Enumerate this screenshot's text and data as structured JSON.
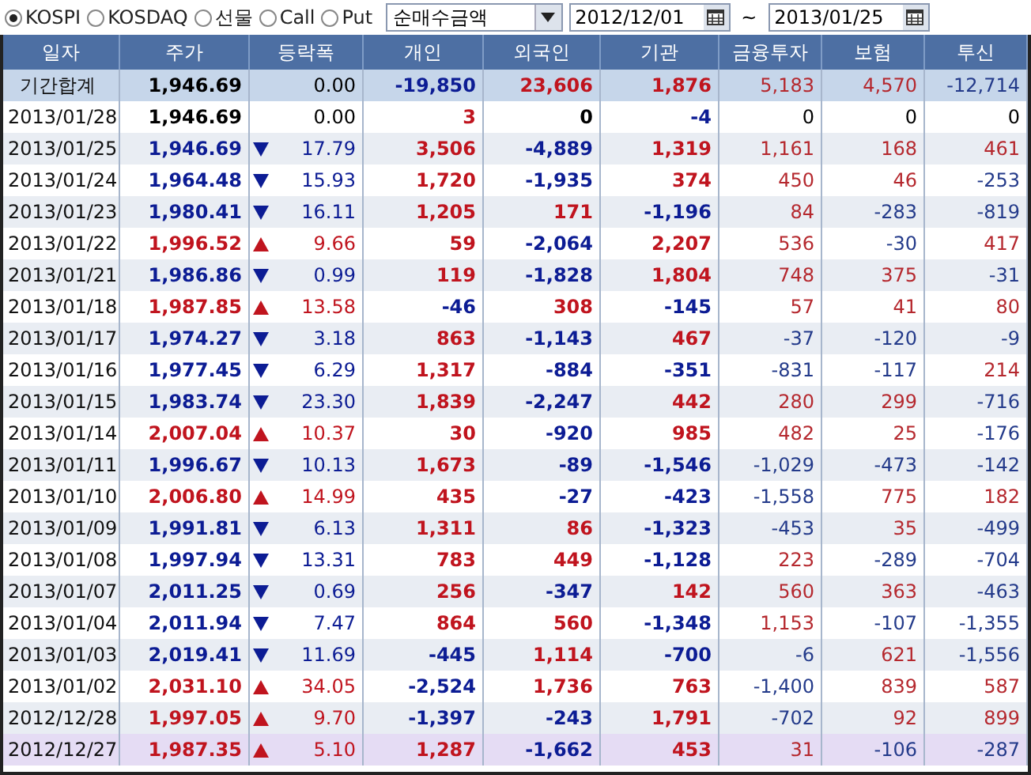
{
  "toolbar": {
    "markets": [
      {
        "label": "KOSPI",
        "selected": true
      },
      {
        "label": "KOSDAQ",
        "selected": false
      },
      {
        "label": "선물",
        "selected": false
      },
      {
        "label": "Call",
        "selected": false
      },
      {
        "label": "Put",
        "selected": false
      }
    ],
    "metric_select": {
      "value": "순매수금액"
    },
    "start_date": {
      "value": "2012/12/01"
    },
    "range_separator": "~",
    "end_date": {
      "value": "2013/01/25"
    }
  },
  "table": {
    "columns": [
      "일자",
      "주가",
      "등락폭",
      "개인",
      "외국인",
      "기관",
      "금융투자",
      "보험",
      "투신"
    ],
    "rows": [
      {
        "kind": "summary",
        "date": "기간합계",
        "price": "1,946.69",
        "rising": false,
        "falling": false,
        "change": "0.00",
        "values": [
          "-19,850",
          "23,606",
          "1,876",
          "5,183",
          "4,570",
          "-12,714"
        ],
        "selected": false
      },
      {
        "kind": "day",
        "date": "2013/01/28",
        "price": "1,946.69",
        "rising": false,
        "falling": false,
        "change": "0.00",
        "values": [
          "3",
          "0",
          "-4",
          "0",
          "0",
          "0"
        ],
        "selected": false
      },
      {
        "kind": "day",
        "date": "2013/01/25",
        "price": "1,946.69",
        "rising": false,
        "falling": true,
        "change": "17.79",
        "values": [
          "3,506",
          "-4,889",
          "1,319",
          "1,161",
          "168",
          "461"
        ],
        "selected": false
      },
      {
        "kind": "day",
        "date": "2013/01/24",
        "price": "1,964.48",
        "rising": false,
        "falling": true,
        "change": "15.93",
        "values": [
          "1,720",
          "-1,935",
          "374",
          "450",
          "46",
          "-253"
        ],
        "selected": false
      },
      {
        "kind": "day",
        "date": "2013/01/23",
        "price": "1,980.41",
        "rising": false,
        "falling": true,
        "change": "16.11",
        "values": [
          "1,205",
          "171",
          "-1,196",
          "84",
          "-283",
          "-819"
        ],
        "selected": false
      },
      {
        "kind": "day",
        "date": "2013/01/22",
        "price": "1,996.52",
        "rising": true,
        "falling": false,
        "change": "9.66",
        "values": [
          "59",
          "-2,064",
          "2,207",
          "536",
          "-30",
          "417"
        ],
        "selected": false
      },
      {
        "kind": "day",
        "date": "2013/01/21",
        "price": "1,986.86",
        "rising": false,
        "falling": true,
        "change": "0.99",
        "values": [
          "119",
          "-1,828",
          "1,804",
          "748",
          "375",
          "-31"
        ],
        "selected": false
      },
      {
        "kind": "day",
        "date": "2013/01/18",
        "price": "1,987.85",
        "rising": true,
        "falling": false,
        "change": "13.58",
        "values": [
          "-46",
          "308",
          "-145",
          "57",
          "41",
          "80"
        ],
        "selected": false
      },
      {
        "kind": "day",
        "date": "2013/01/17",
        "price": "1,974.27",
        "rising": false,
        "falling": true,
        "change": "3.18",
        "values": [
          "863",
          "-1,143",
          "467",
          "-37",
          "-120",
          "-9"
        ],
        "selected": false
      },
      {
        "kind": "day",
        "date": "2013/01/16",
        "price": "1,977.45",
        "rising": false,
        "falling": true,
        "change": "6.29",
        "values": [
          "1,317",
          "-884",
          "-351",
          "-831",
          "-117",
          "214"
        ],
        "selected": false
      },
      {
        "kind": "day",
        "date": "2013/01/15",
        "price": "1,983.74",
        "rising": false,
        "falling": true,
        "change": "23.30",
        "values": [
          "1,839",
          "-2,247",
          "442",
          "280",
          "299",
          "-716"
        ],
        "selected": false
      },
      {
        "kind": "day",
        "date": "2013/01/14",
        "price": "2,007.04",
        "rising": true,
        "falling": false,
        "change": "10.37",
        "values": [
          "30",
          "-920",
          "985",
          "482",
          "25",
          "-176"
        ],
        "selected": false
      },
      {
        "kind": "day",
        "date": "2013/01/11",
        "price": "1,996.67",
        "rising": false,
        "falling": true,
        "change": "10.13",
        "values": [
          "1,673",
          "-89",
          "-1,546",
          "-1,029",
          "-473",
          "-142"
        ],
        "selected": false
      },
      {
        "kind": "day",
        "date": "2013/01/10",
        "price": "2,006.80",
        "rising": true,
        "falling": false,
        "change": "14.99",
        "values": [
          "435",
          "-27",
          "-423",
          "-1,558",
          "775",
          "182"
        ],
        "selected": false
      },
      {
        "kind": "day",
        "date": "2013/01/09",
        "price": "1,991.81",
        "rising": false,
        "falling": true,
        "change": "6.13",
        "values": [
          "1,311",
          "86",
          "-1,323",
          "-453",
          "35",
          "-499"
        ],
        "selected": false
      },
      {
        "kind": "day",
        "date": "2013/01/08",
        "price": "1,997.94",
        "rising": false,
        "falling": true,
        "change": "13.31",
        "values": [
          "783",
          "449",
          "-1,128",
          "223",
          "-289",
          "-704"
        ],
        "selected": false
      },
      {
        "kind": "day",
        "date": "2013/01/07",
        "price": "2,011.25",
        "rising": false,
        "falling": true,
        "change": "0.69",
        "values": [
          "256",
          "-347",
          "142",
          "560",
          "363",
          "-463"
        ],
        "selected": false
      },
      {
        "kind": "day",
        "date": "2013/01/04",
        "price": "2,011.94",
        "rising": false,
        "falling": true,
        "change": "7.47",
        "values": [
          "864",
          "560",
          "-1,348",
          "1,153",
          "-107",
          "-1,355"
        ],
        "selected": false
      },
      {
        "kind": "day",
        "date": "2013/01/03",
        "price": "2,019.41",
        "rising": false,
        "falling": true,
        "change": "11.69",
        "values": [
          "-445",
          "1,114",
          "-700",
          "-6",
          "621",
          "-1,556"
        ],
        "selected": false
      },
      {
        "kind": "day",
        "date": "2013/01/02",
        "price": "2,031.10",
        "rising": true,
        "falling": false,
        "change": "34.05",
        "values": [
          "-2,524",
          "1,736",
          "763",
          "-1,400",
          "839",
          "587"
        ],
        "selected": false
      },
      {
        "kind": "day",
        "date": "2012/12/28",
        "price": "1,997.05",
        "rising": true,
        "falling": false,
        "change": "9.70",
        "values": [
          "-1,397",
          "-243",
          "1,791",
          "-702",
          "92",
          "899"
        ],
        "selected": false
      },
      {
        "kind": "day",
        "date": "2012/12/27",
        "price": "1,987.35",
        "rising": true,
        "falling": false,
        "change": "5.10",
        "values": [
          "1,287",
          "-1,662",
          "453",
          "31",
          "-106",
          "-287"
        ],
        "selected": true
      }
    ]
  }
}
